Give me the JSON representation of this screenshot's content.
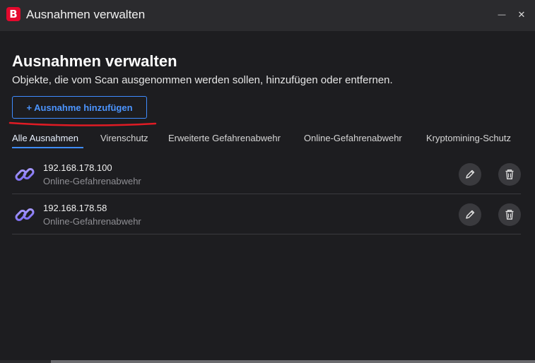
{
  "window": {
    "logo_letter": "B",
    "title": "Ausnahmen verwalten",
    "minimize_glyph": "—",
    "close_glyph": "✕"
  },
  "page": {
    "title": "Ausnahmen verwalten",
    "subtitle": "Objekte, die vom Scan ausgenommen werden sollen, hinzufügen oder entfernen."
  },
  "add_button": {
    "label": "+ Ausnahme hinzufügen"
  },
  "tabs": [
    {
      "label": "Alle Ausnahmen",
      "active": true
    },
    {
      "label": "Virenschutz",
      "active": false
    },
    {
      "label": "Erweiterte Gefahrenabwehr",
      "active": false
    },
    {
      "label": "Online-Gefahrenabwehr",
      "active": false
    },
    {
      "label": "Kryptomining-Schutz",
      "active": false
    }
  ],
  "exceptions": [
    {
      "address": "192.168.178.100",
      "module": "Online-Gefahrenabwehr",
      "icon": "link-icon"
    },
    {
      "address": "192.168.178.58",
      "module": "Online-Gefahrenabwehr",
      "icon": "link-icon"
    }
  ],
  "colors": {
    "accent": "#3f8cff",
    "brand": "#e4092d",
    "annotation": "#e01b24"
  }
}
